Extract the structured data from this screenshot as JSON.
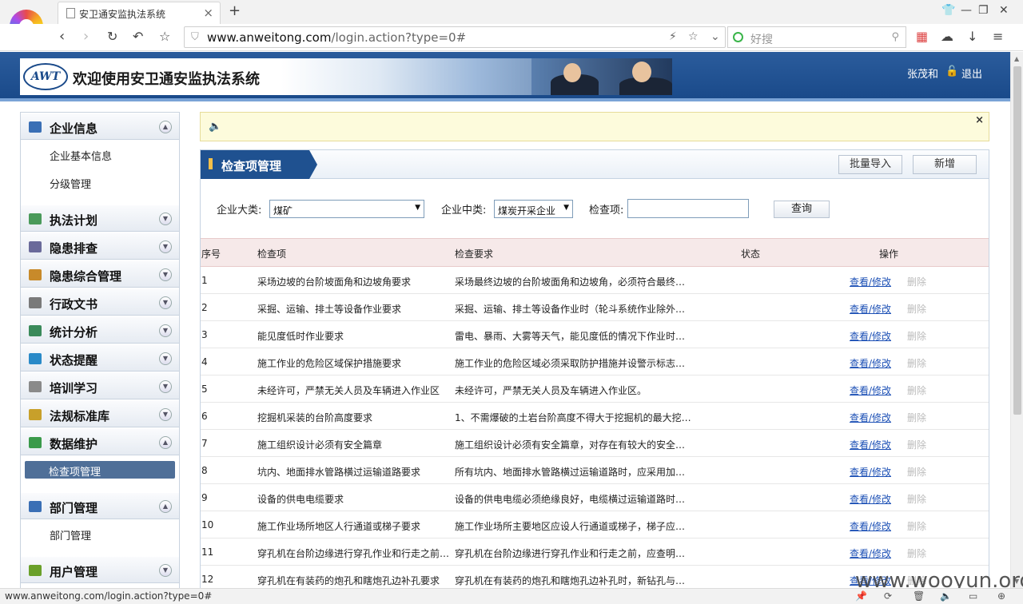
{
  "browser": {
    "tab_title": "安卫通安监执法系统",
    "url_host": "www.anweitong.com",
    "url_path": "/login.action?type=0#",
    "search_placeholder": "好搜",
    "status_text": "www.anweitong.com/login.action?type=0#"
  },
  "header": {
    "logo_text": "AWT",
    "site_title": "欢迎使用安卫通安监执法系统",
    "user_name": "张茂和",
    "logout_label": "退出"
  },
  "sidebar": {
    "sections": [
      {
        "label": "企业信息",
        "icon": "building-icon",
        "expanded": true,
        "items": [
          "企业基本信息",
          "分级管理"
        ]
      },
      {
        "label": "执法计划",
        "icon": "calendar-icon",
        "expanded": false
      },
      {
        "label": "隐患排查",
        "icon": "magnifier-icon",
        "expanded": false
      },
      {
        "label": "隐患综合管理",
        "icon": "folder-icon",
        "expanded": false
      },
      {
        "label": "行政文书",
        "icon": "document-icon",
        "expanded": false
      },
      {
        "label": "统计分析",
        "icon": "chart-icon",
        "expanded": false
      },
      {
        "label": "状态提醒",
        "icon": "bubble-icon",
        "expanded": false
      },
      {
        "label": "培训学习",
        "icon": "keyboard-icon",
        "expanded": false
      },
      {
        "label": "法规标准库",
        "icon": "tools-icon",
        "expanded": false
      },
      {
        "label": "数据维护",
        "icon": "checkbox-icon",
        "expanded": true,
        "items": [
          "检查项管理"
        ]
      },
      {
        "label": "部门管理",
        "icon": "org-chart-icon",
        "expanded": true,
        "items": [
          "部门管理"
        ]
      },
      {
        "label": "用户管理",
        "icon": "user-icon",
        "expanded": false
      }
    ]
  },
  "panel": {
    "title": "检查项管理",
    "batch_import_label": "批量导入",
    "add_label": "新增",
    "filters": {
      "category_label": "企业大类:",
      "category_value": "煤矿",
      "subcategory_label": "企业中类:",
      "subcategory_value": "煤炭开采企业",
      "item_label": "检查项:",
      "item_value": "",
      "query_label": "查询"
    },
    "columns": [
      "序号",
      "检查项",
      "检查要求",
      "状态",
      "操作"
    ],
    "view_label": "查看/修改",
    "delete_label": "删除",
    "rows": [
      {
        "no": "1",
        "item": "采场边坡的台阶坡面角和边坡角要求",
        "requirement": "采场最终边坡的台阶坡面角和边坡角，必须符合最终…"
      },
      {
        "no": "2",
        "item": "采掘、运输、排土等设备作业要求",
        "requirement": "采掘、运输、排土等设备作业时（轮斗系统作业除外…"
      },
      {
        "no": "3",
        "item": "能见度低时作业要求",
        "requirement": "雷电、暴雨、大雾等天气，能见度低的情况下作业时…"
      },
      {
        "no": "4",
        "item": "施工作业的危险区域保护措施要求",
        "requirement": "施工作业的危险区域必须采取防护措施并设警示标志…"
      },
      {
        "no": "5",
        "item": "未经许可，严禁无关人员及车辆进入作业区",
        "requirement": "未经许可，严禁无关人员及车辆进入作业区。"
      },
      {
        "no": "6",
        "item": "挖掘机采装的台阶高度要求",
        "requirement": "1、不需爆破的土岩台阶高度不得大于挖掘机的最大挖…"
      },
      {
        "no": "7",
        "item": "施工组织设计必须有安全篇章",
        "requirement": "施工组织设计必须有安全篇章，对存在有较大的安全…"
      },
      {
        "no": "8",
        "item": "坑内、地面排水管路横过运输道路要求",
        "requirement": "所有坑内、地面排水管路横过运输道路时，应采用加…"
      },
      {
        "no": "9",
        "item": "设备的供电电缆要求",
        "requirement": "设备的供电电缆必须绝缘良好，电缆横过运输道路时…"
      },
      {
        "no": "10",
        "item": "施工作业场所地区人行通道或梯子要求",
        "requirement": "施工作业场所主要地区应设人行通道或梯子，梯子应…"
      },
      {
        "no": "11",
        "item": "穿孔机在台阶边缘进行穿孔作业和行走之前…",
        "requirement": "穿孔机在台阶边缘进行穿孔作业和行走之前，应查明…"
      },
      {
        "no": "12",
        "item": "穿孔机在有装药的炮孔和瞎炮孔边补孔要求",
        "requirement": "穿孔机在有装药的炮孔和瞎炮孔边补孔时，新钻孔与…"
      }
    ]
  },
  "watermark": "www.wooyun.org",
  "colors": {
    "header_blue": "#1f5190",
    "link_blue": "#1b4fb5",
    "notice_bg": "#fdfbdc",
    "table_head_bg": "#f6e9e9"
  }
}
